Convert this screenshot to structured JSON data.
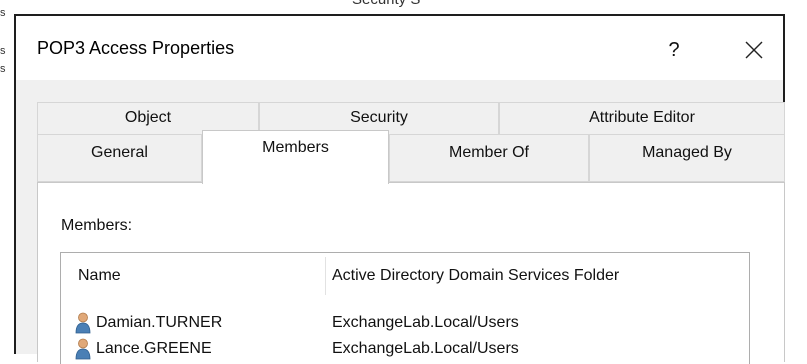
{
  "background": {
    "partial_text": "Security S",
    "edge_marks": [
      "s",
      "s",
      "s"
    ]
  },
  "dialog": {
    "title": "POP3 Access Properties",
    "help_label": "?",
    "close_icon": "close-icon"
  },
  "tabs": {
    "row1": [
      "Object",
      "Security",
      "Attribute Editor"
    ],
    "row2": [
      "General",
      "Members",
      "Member Of",
      "Managed By"
    ],
    "active": "Members"
  },
  "members": {
    "label": "Members:",
    "columns": [
      "Name",
      "Active Directory Domain Services Folder"
    ],
    "rows": [
      {
        "name": "Damian.TURNER",
        "folder": "ExchangeLab.Local/Users",
        "icon": "user-icon"
      },
      {
        "name": "Lance.GREENE",
        "folder": "ExchangeLab.Local/Users",
        "icon": "user-icon"
      }
    ]
  },
  "colors": {
    "dialog_border": "#1e1e1e",
    "dialog_bg": "#f0f0f0",
    "panel_bg": "#ffffff",
    "user_icon_head": "#e0a878",
    "user_icon_body": "#4a7fb5"
  }
}
